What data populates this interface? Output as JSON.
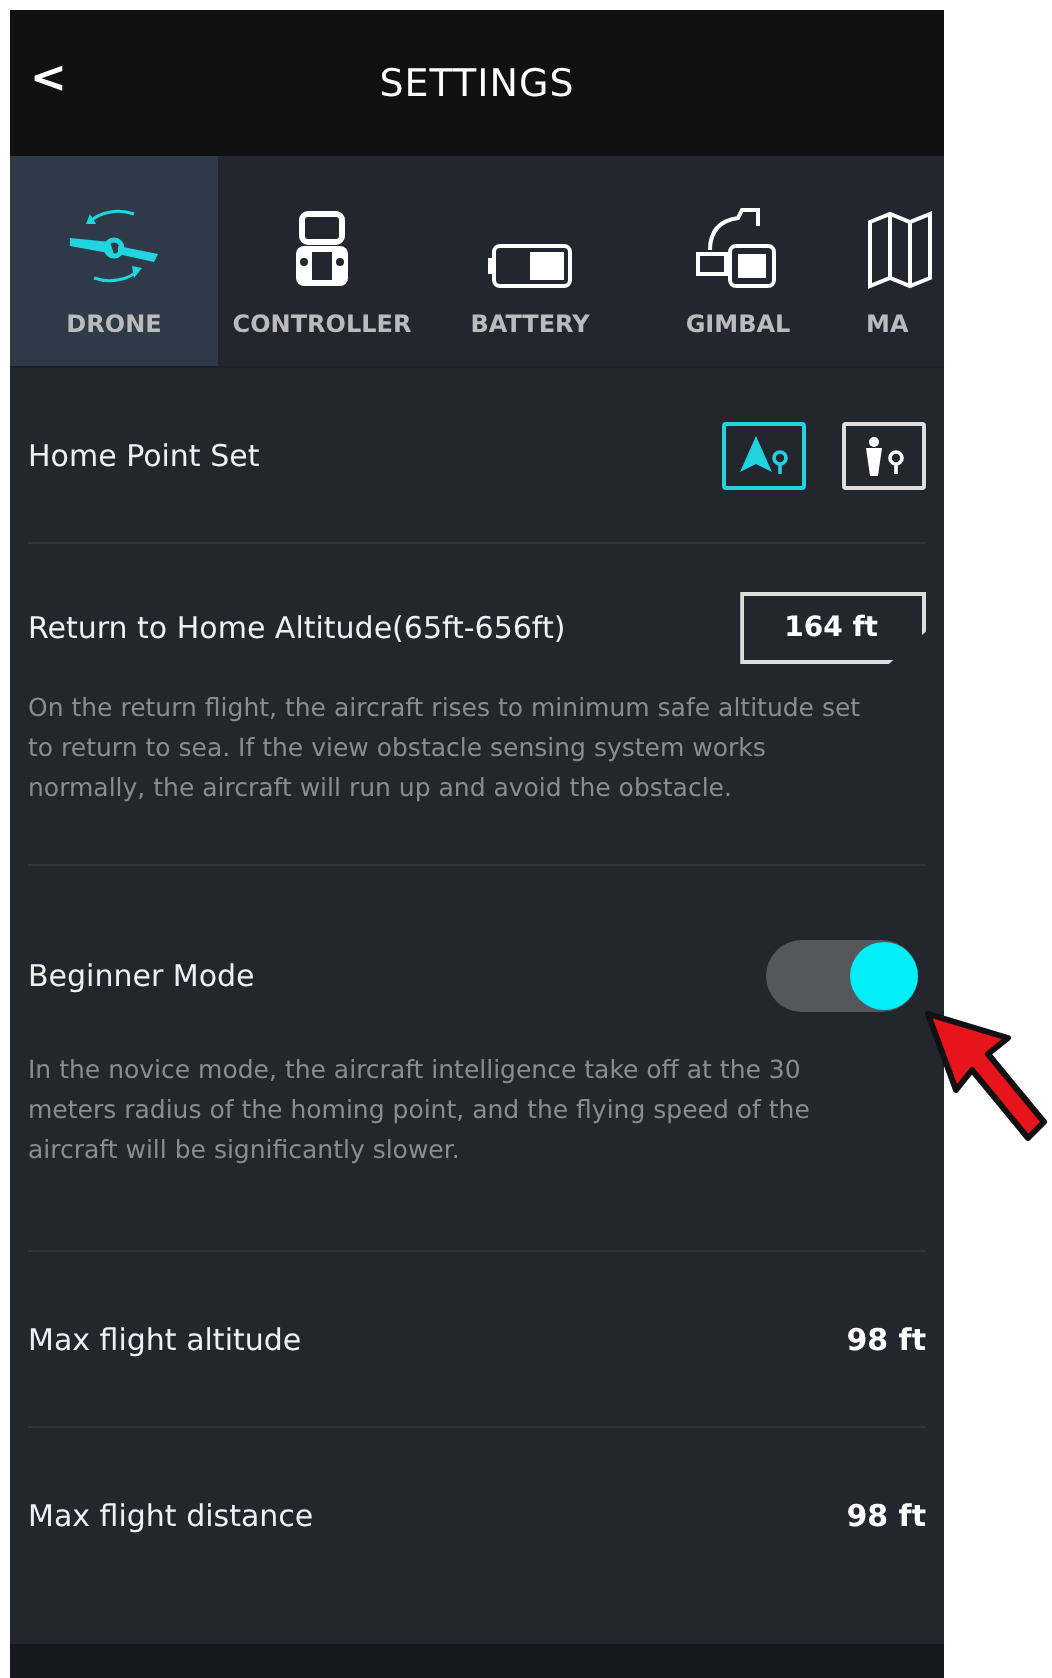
{
  "header": {
    "back": "<",
    "title": "SETTINGS"
  },
  "tabs": [
    {
      "label": "DRONE",
      "kind": "drone",
      "selected": true
    },
    {
      "label": "CONTROLLER",
      "kind": "controller",
      "selected": false
    },
    {
      "label": "BATTERY",
      "kind": "battery",
      "selected": false
    },
    {
      "label": "GIMBAL",
      "kind": "gimbal",
      "selected": false
    },
    {
      "label": "MA",
      "kind": "map",
      "selected": false
    }
  ],
  "home_point": {
    "label": "Home Point Set",
    "options": [
      {
        "kind": "aircraft",
        "selected": true
      },
      {
        "kind": "person",
        "selected": false
      }
    ]
  },
  "return_altitude": {
    "label": "Return to Home Altitude(65ft-656ft)",
    "value": "164 ft",
    "description": "On the return flight, the aircraft rises to minimum safe altitude set to return to sea. If the view obstacle sensing system works normally, the aircraft will run up and avoid the obstacle."
  },
  "beginner_mode": {
    "label": "Beginner Mode",
    "on": true,
    "description": "In the novice mode, the aircraft intelligence take off at the 30 meters radius of the homing point, and the flying speed of the aircraft will be significantly slower."
  },
  "limits": [
    {
      "label": "Max flight altitude",
      "value": "98 ft"
    },
    {
      "label": "Max flight distance",
      "value": "98 ft"
    }
  ]
}
